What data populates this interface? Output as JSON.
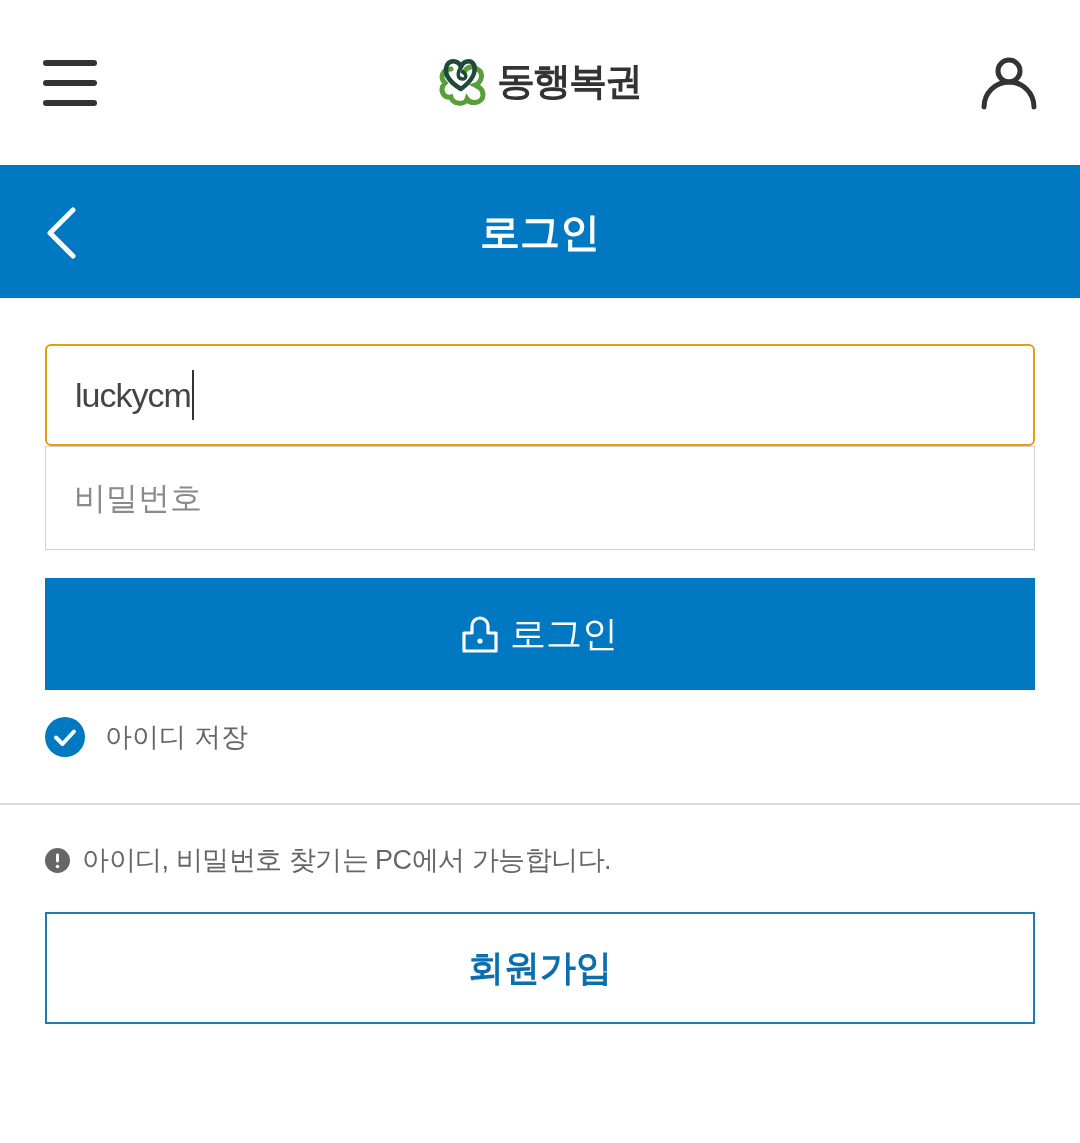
{
  "header": {
    "logo_text": "동행복권"
  },
  "page_bar": {
    "title": "로그인"
  },
  "form": {
    "id_field": {
      "value": "luckycm",
      "focused": true
    },
    "password_field": {
      "placeholder": "비밀번호"
    },
    "login_button": {
      "label": "로그인"
    },
    "save_id": {
      "label": "아이디 저장",
      "checked": true
    }
  },
  "notice": {
    "text": "아이디, 비밀번호 찾기는 PC에서 가능합니다."
  },
  "signup_button": {
    "label": "회원가입"
  }
}
